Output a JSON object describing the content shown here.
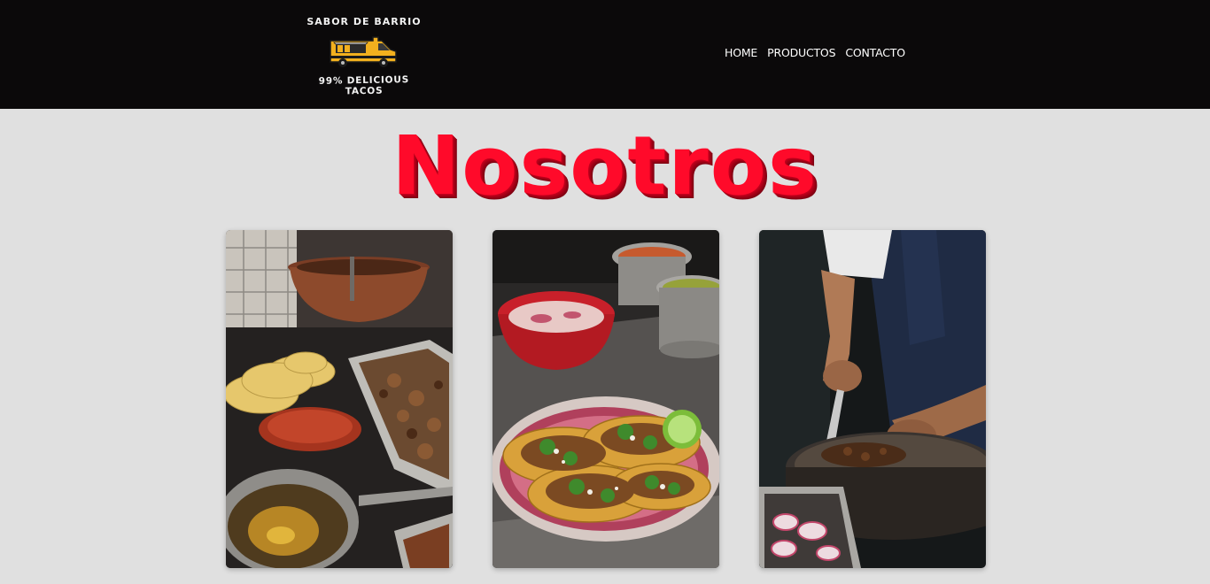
{
  "header": {
    "logo_top_text": "SABOR DE BARRIO",
    "logo_bottom_text": "99% DELICIOUS TACOS",
    "nav": [
      {
        "label": "HOME"
      },
      {
        "label": "PRODUCTOS"
      },
      {
        "label": "CONTACTO"
      }
    ]
  },
  "main": {
    "title": "Nosotros"
  },
  "colors": {
    "header_bg": "#0b090a",
    "page_bg": "#e0e0e0",
    "title_red": "#ff0a2a",
    "truck_yellow": "#f2b01e"
  },
  "icons": {
    "logo": "food-truck-icon"
  }
}
